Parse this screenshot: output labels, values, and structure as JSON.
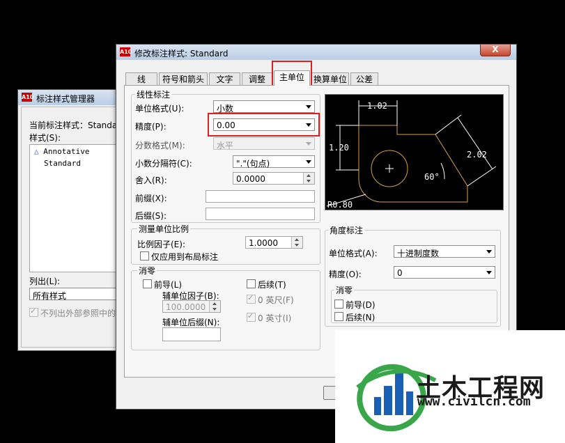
{
  "back_window": {
    "title": "标注样式管理器",
    "current_style_label": "当前标注样式：Standa",
    "styles_label": "样式(S):",
    "styles": [
      "Annotative",
      "Standard"
    ],
    "list_label": "列出(L):",
    "list_value": "所有样式",
    "exclude_xref_label": "不列出外部参照中的"
  },
  "dialog": {
    "title": "修改标注样式: Standard",
    "close_label": "X",
    "tabs": [
      "线",
      "符号和箭头",
      "文字",
      "调整",
      "主单位",
      "换算单位",
      "公差"
    ],
    "active_tab": "主单位",
    "linear": {
      "group_label": "线性标注",
      "unit_format_label": "单位格式(U):",
      "unit_format_value": "小数",
      "precision_label": "精度(P):",
      "precision_value": "0.00",
      "fraction_format_label": "分数格式(M):",
      "fraction_format_value": "水平",
      "decimal_separator_label": "小数分隔符(C):",
      "decimal_separator_value": "\".\"(句点)",
      "round_off_label": "舍入(R):",
      "round_off_value": "0.0000",
      "prefix_label": "前缀(X):",
      "prefix_value": "",
      "suffix_label": "后缀(S):",
      "suffix_value": ""
    },
    "measurement_scale": {
      "group_label": "测量单位比例",
      "scale_factor_label": "比例因子(E):",
      "scale_factor_value": "1.0000",
      "layout_only_label": "仅应用到布局标注"
    },
    "zero_suppression": {
      "group_label": "消零",
      "leading_label": "前导(L)",
      "sub_units_factor_label": "辅单位因子(B):",
      "sub_units_factor_value": "100.0000",
      "sub_units_suffix_label": "辅单位后缀(N):",
      "sub_units_suffix_value": "",
      "trailing_label": "后续(T)",
      "feet_label": "0 英尺(F)",
      "inches_label": "0 英寸(I)"
    },
    "preview": {
      "dim_top": "1.02",
      "dim_left": "1.20",
      "dim_right": "2.02",
      "dim_angle": "60°",
      "dim_radius": "R0.80",
      "line_color": "#d8a048",
      "text_color": "#ffffff"
    },
    "angular": {
      "group_label": "角度标注",
      "unit_format_label": "单位格式(A):",
      "unit_format_value": "十进制度数",
      "precision_label": "精度(O):",
      "precision_value": "0",
      "zero_group_label": "消零",
      "leading_label": "前导(D)",
      "trailing_label": "后续(N)"
    }
  },
  "watermark": {
    "brand_text": "土木工程网",
    "url_text": "www.civilcn.com"
  },
  "colors": {
    "highlight": "#e02020",
    "logo_green": "#3aa64a",
    "logo_blue": "#1a5fb4"
  }
}
